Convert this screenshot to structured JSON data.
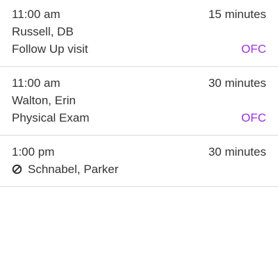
{
  "appointments": [
    {
      "time": "11:00 am",
      "duration": "15 minutes",
      "patient": "Russell, DB",
      "visit_type": "Follow Up visit",
      "location": "OFC",
      "cancelled": false
    },
    {
      "time": "11:00 am",
      "duration": "30 minutes",
      "patient": "Walton, Erin",
      "visit_type": "Physical Exam",
      "location": "OFC",
      "cancelled": false
    },
    {
      "time": "1:00 pm",
      "duration": "30 minutes",
      "patient": "Schnabel, Parker",
      "icon": "cancel-icon",
      "cancelled": true
    }
  ],
  "colors": {
    "text": "#333333",
    "location": "#9b30e0",
    "divider": "#d9d9d9"
  }
}
